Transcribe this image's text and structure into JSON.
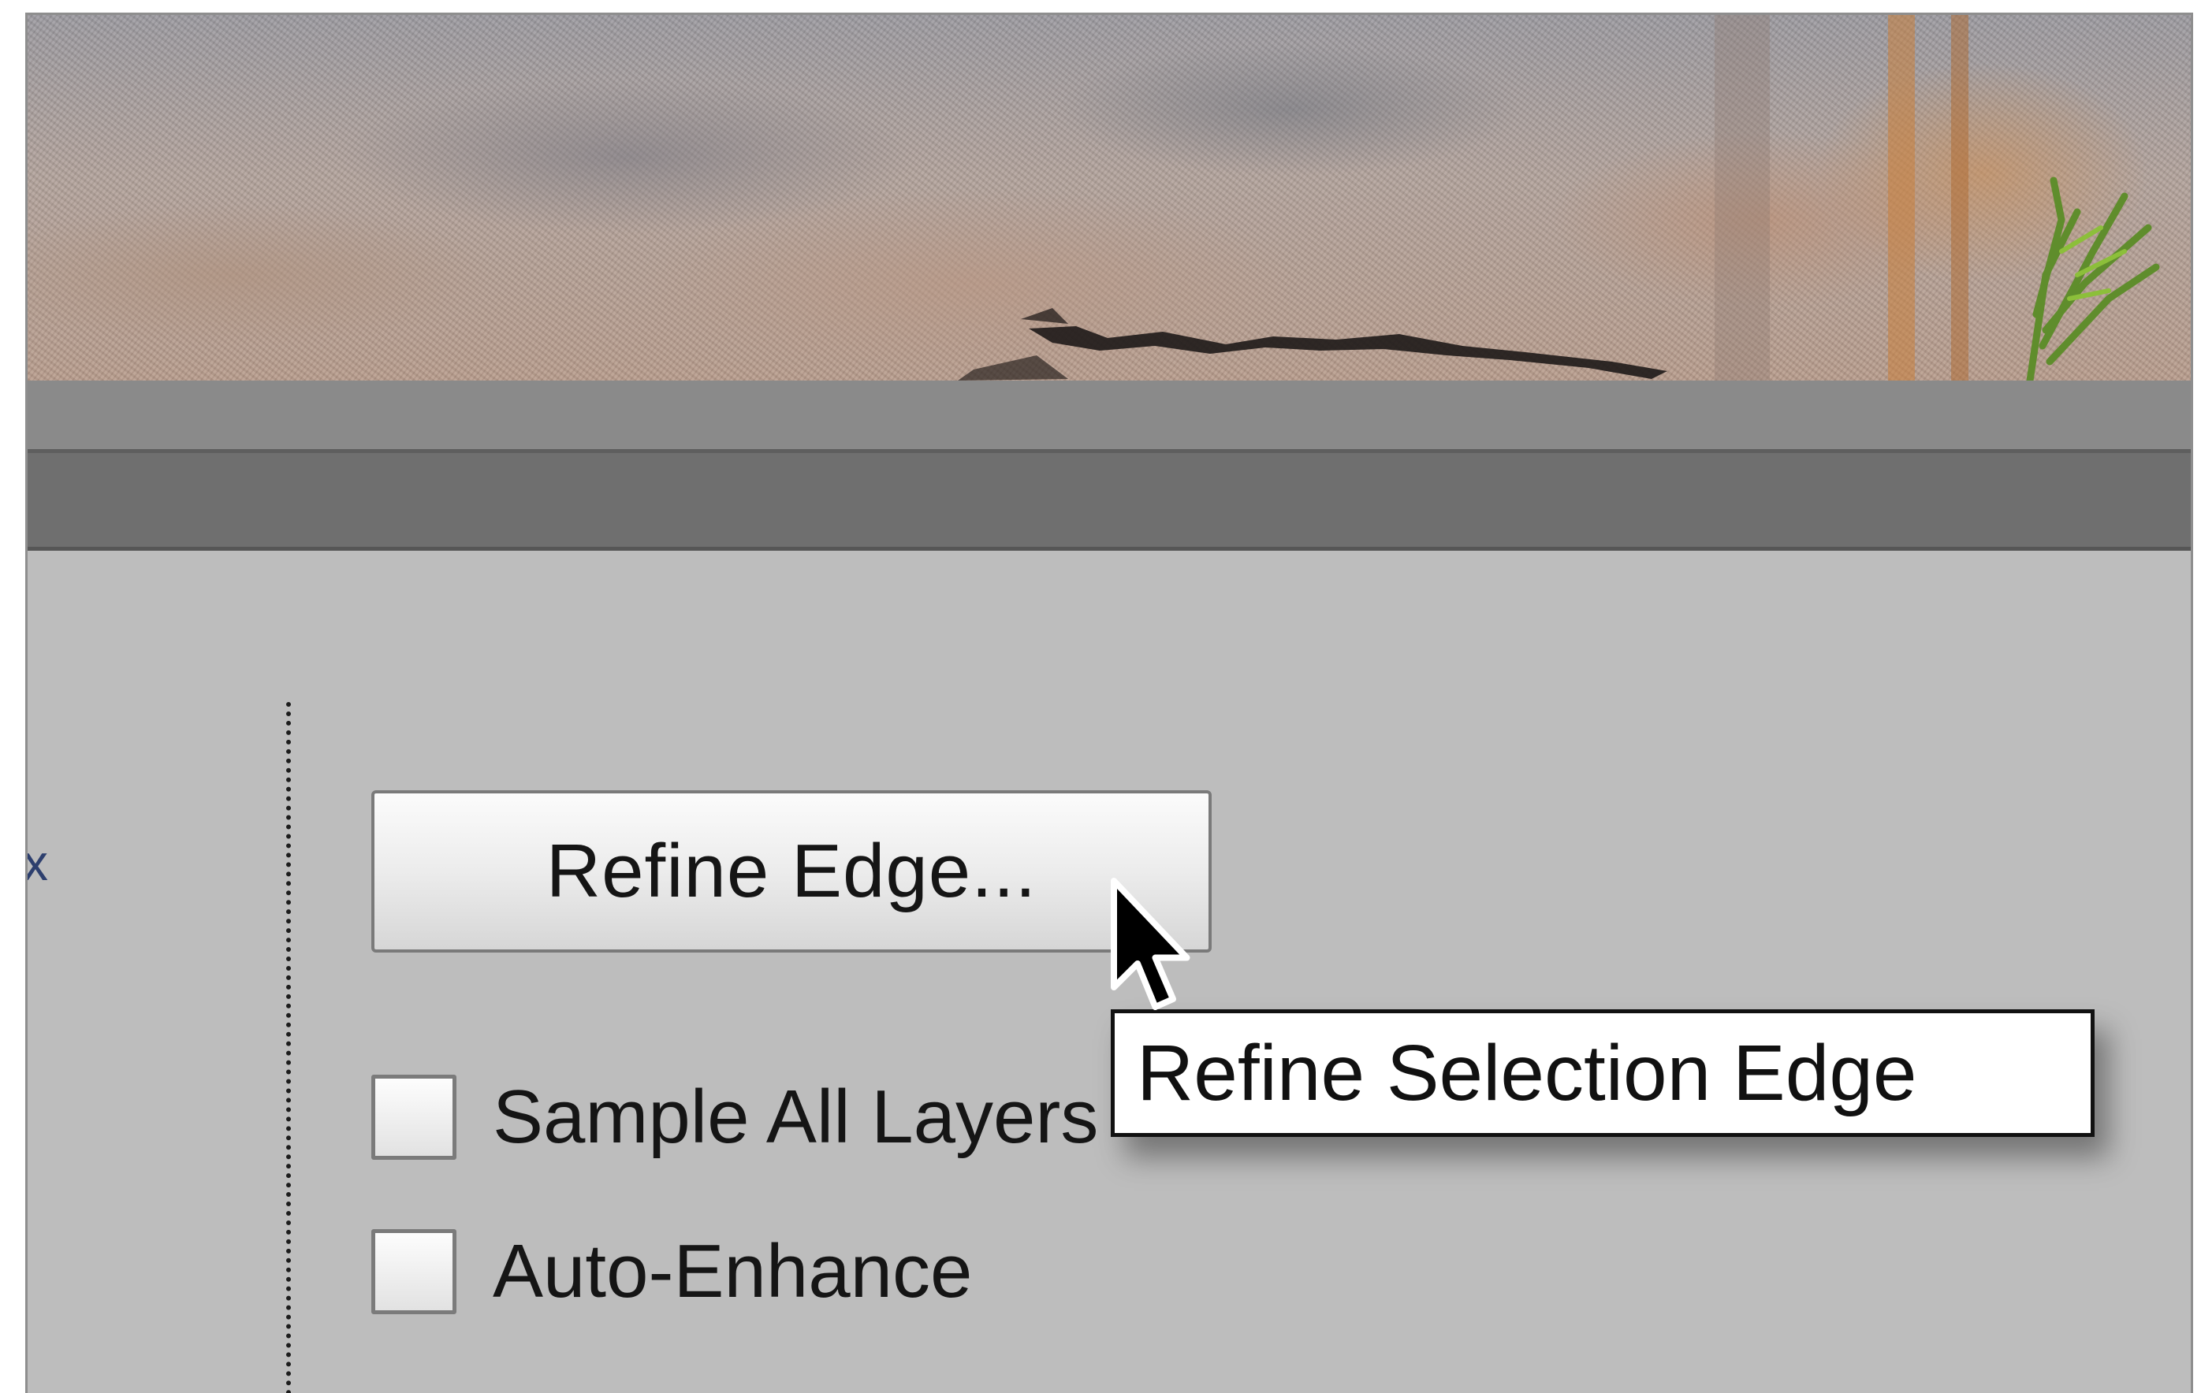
{
  "options_bar": {
    "refine_button_label": "Refine Edge...",
    "checkboxes": [
      {
        "label": "Sample All Layers",
        "checked": false
      },
      {
        "label": "Auto-Enhance",
        "checked": false
      }
    ],
    "edge_glyph": "x"
  },
  "tooltip": {
    "text": "Refine Selection Edge"
  },
  "icons": {
    "pointer": "arrow-cursor-icon"
  },
  "colors": {
    "panel_bg": "#bdbdbd",
    "bar_light": "#8a8a8a",
    "bar_dark": "#6f6f6f",
    "tooltip_bg": "#ffffff"
  }
}
